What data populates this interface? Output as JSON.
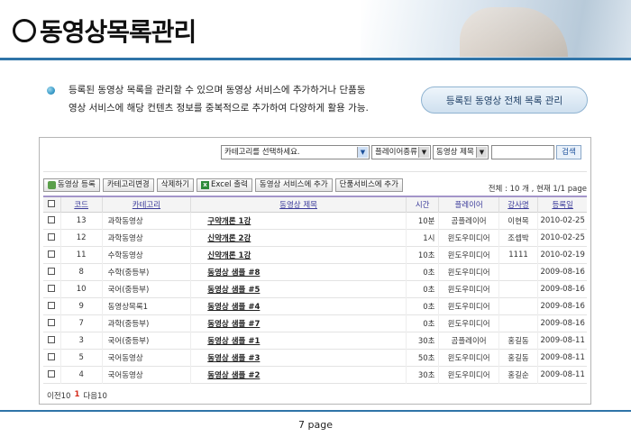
{
  "header": {
    "title": "동영상목록관리"
  },
  "intro": {
    "line1": "등록된 동영상 목록을 관리할 수 있으며 동영상 서비스에 추가하거나 단품동",
    "line2": "영상 서비스에 해당 컨텐츠 정보를 중복적으로 추가하여 다양하게 활용 가능.",
    "button_label": "등록된 동영상 전체 목록 관리"
  },
  "filters": {
    "category_placeholder": "카테고리를 선택하세요.",
    "player_select": "플레이어종류",
    "field_select": "동영상 제목",
    "search_label": "검색"
  },
  "toolbar": {
    "register": "동영상 등록",
    "category_change": "카테고리변경",
    "delete": "삭제하기",
    "excel": "Excel 출력",
    "add_service": "동영상 서비스에 추가",
    "add_single": "단품서비스에 추가"
  },
  "summary": "전체 : 10 개 , 현재 1/1 page",
  "table": {
    "headers": [
      "코드",
      "카테고리",
      "동영상 제목",
      "시간",
      "플레이어",
      "강사명",
      "등록일"
    ],
    "rows": [
      {
        "code": "13",
        "category": "과학동영상",
        "title": "구약개론 1강",
        "time": "10분",
        "player": "곰플레이어",
        "teacher": "이현목",
        "date": "2010-02-25"
      },
      {
        "code": "12",
        "category": "과학동영상",
        "title": "신약개론 2강",
        "time": "1시",
        "player": "윈도우미디어",
        "teacher": "조셉박",
        "date": "2010-02-25"
      },
      {
        "code": "11",
        "category": "수학동영상",
        "title": "신약개론 1강",
        "time": "10초",
        "player": "윈도우미디어",
        "teacher": "1111",
        "date": "2010-02-19"
      },
      {
        "code": "8",
        "category": "수학(중등부)",
        "title": "동영상 샘플 #8",
        "time": "0초",
        "player": "윈도우미디어",
        "teacher": "",
        "date": "2009-08-16"
      },
      {
        "code": "10",
        "category": "국어(중등부)",
        "title": "동영상 샘플 #5",
        "time": "0초",
        "player": "윈도우미디어",
        "teacher": "",
        "date": "2009-08-16"
      },
      {
        "code": "9",
        "category": "동영상목록1",
        "title": "동영상 샘플 #4",
        "time": "0초",
        "player": "윈도우미디어",
        "teacher": "",
        "date": "2009-08-16"
      },
      {
        "code": "7",
        "category": "과학(중등부)",
        "title": "동영상 샘플 #7",
        "time": "0초",
        "player": "윈도우미디어",
        "teacher": "",
        "date": "2009-08-16"
      },
      {
        "code": "3",
        "category": "국어(중등부)",
        "title": "동영상 샘플 #1",
        "time": "30초",
        "player": "곰플레이어",
        "teacher": "홍길동",
        "date": "2009-08-11"
      },
      {
        "code": "5",
        "category": "국어동영상",
        "title": "동영상 샘플 #3",
        "time": "50초",
        "player": "윈도우미디어",
        "teacher": "홍길동",
        "date": "2009-08-11"
      },
      {
        "code": "4",
        "category": "국어동영상",
        "title": "동영상 샘플 #2",
        "time": "30초",
        "player": "윈도우미디어",
        "teacher": "홍길순",
        "date": "2009-08-11"
      }
    ]
  },
  "pager": {
    "prev": "이전10",
    "current": "1",
    "next": "다음10"
  },
  "footer": {
    "page": "7 page"
  },
  "colors": {
    "accent_line": "#2f74a8",
    "table_header_border": "#a395c9",
    "pager_current": "#d42a1a"
  }
}
